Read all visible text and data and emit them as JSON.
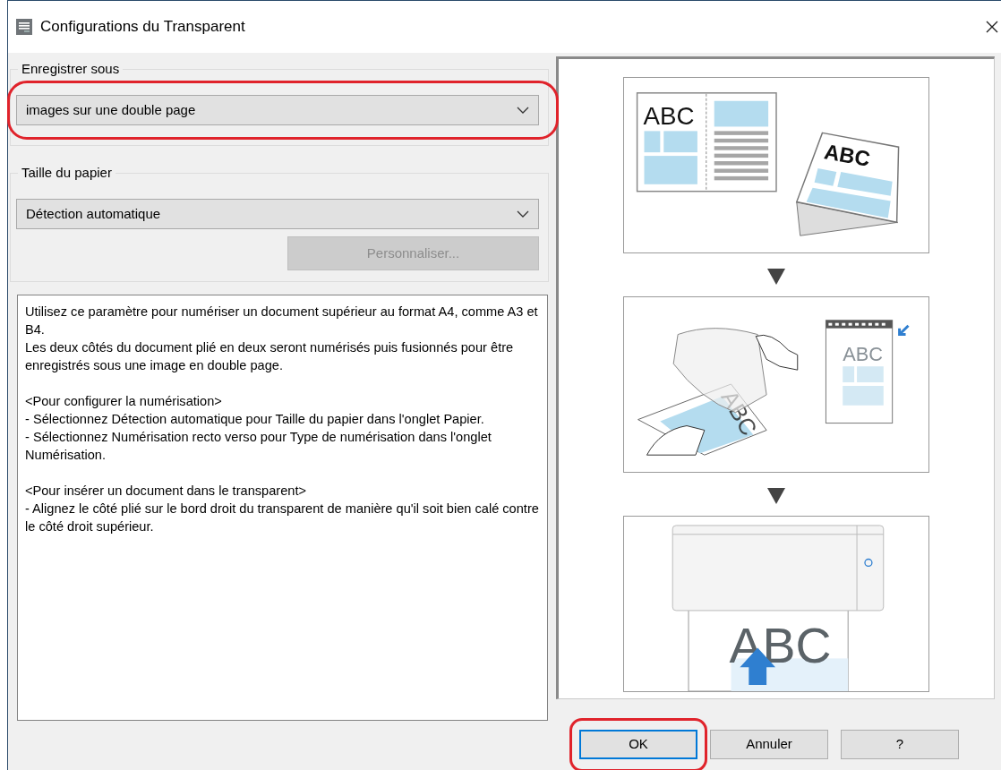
{
  "window": {
    "title": "Configurations du Transparent"
  },
  "save_as": {
    "legend": "Enregistrer sous",
    "value": "images sur une double page",
    "highlighted": true
  },
  "paper_size": {
    "legend": "Taille du papier",
    "value": "Détection automatique",
    "customize_button": {
      "label": "Personnaliser...",
      "disabled": true
    }
  },
  "description": [
    [
      "Utilisez ce paramètre pour numériser un document supérieur au format A4, comme A3 et B4.",
      "Les deux côtés du document plié en deux seront numérisés puis fusionnés pour être enregistrés sous une image en double page."
    ],
    [
      "<Pour configurer la numérisation>",
      "- Sélectionnez Détection automatique pour Taille du papier dans l'onglet Papier.",
      "- Sélectionnez Numérisation recto verso pour Type de numérisation dans l'onglet Numérisation."
    ],
    [
      "<Pour insérer un document dans le transparent>",
      "- Alignez le côté plié sur le bord droit du transparent de manière qu'il soit bien calé contre le côté droit supérieur."
    ]
  ],
  "illustration": {
    "panels": [
      {
        "kind": "spread",
        "labels": [
          "ABC",
          "ABC"
        ]
      },
      {
        "kind": "insert",
        "labels": [
          "ABC",
          "ABC"
        ]
      },
      {
        "kind": "scan",
        "labels": [
          "ABC"
        ]
      }
    ]
  },
  "buttons": [
    {
      "label": "OK",
      "default": true,
      "highlighted": true
    },
    {
      "label": "Annuler",
      "default": false,
      "highlighted": false
    },
    {
      "label": "?",
      "default": false,
      "highlighted": false
    }
  ]
}
